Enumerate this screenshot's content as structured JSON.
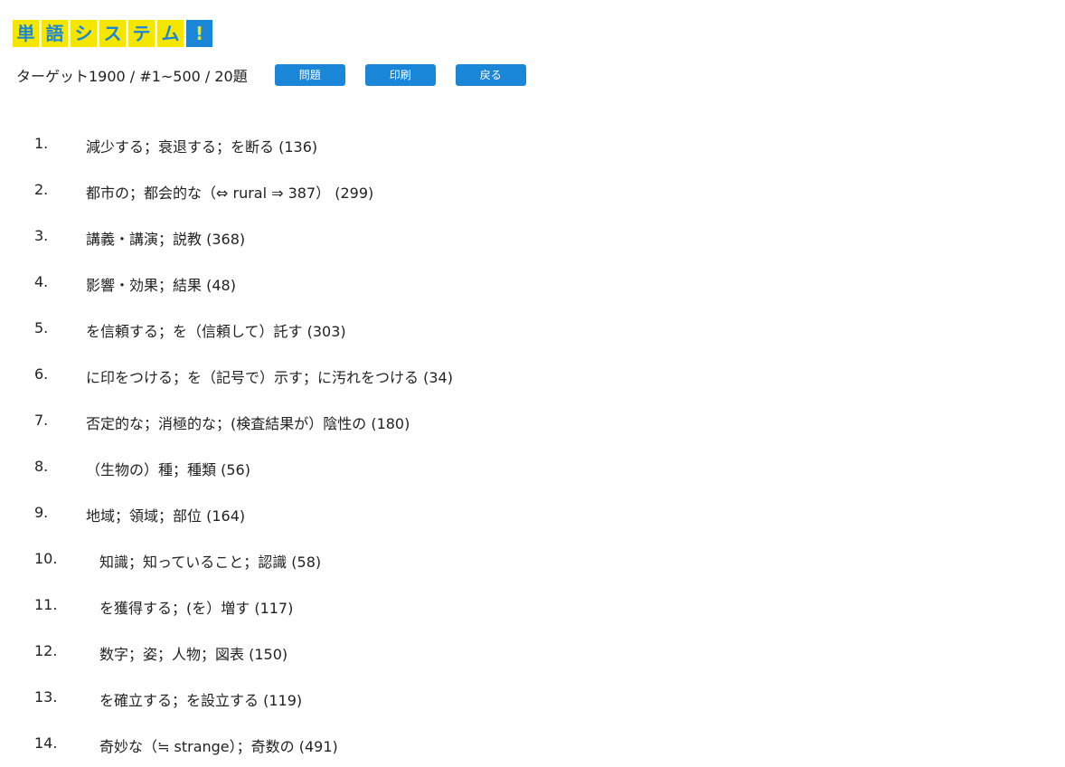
{
  "logo": {
    "chars": [
      "単",
      "語",
      "シ",
      "ス",
      "テ",
      "ム",
      "!"
    ],
    "colors": {
      "tile_bg": "#f5e600",
      "tile_fg": "#1a86d8"
    }
  },
  "header": {
    "title": "ターゲット1900 / #1~500 / 20題",
    "buttons": {
      "question": "問題",
      "print": "印刷",
      "back": "戻る"
    },
    "accent": "#1a86d8"
  },
  "items": [
    {
      "num": "1.",
      "text": "減少する；衰退する；を断る (136)"
    },
    {
      "num": "2.",
      "text": "都市の；都会的な（⇔ rural ⇒ 387） (299)"
    },
    {
      "num": "3.",
      "text": "講義・講演；説教 (368)"
    },
    {
      "num": "4.",
      "text": "影響・効果；結果 (48)"
    },
    {
      "num": "5.",
      "text": "を信頼する；を（信頼して）託す (303)"
    },
    {
      "num": "6.",
      "text": "に印をつける；を（記号で）示す；に汚れをつける (34)"
    },
    {
      "num": "7.",
      "text": "否定的な；消極的な；(検査結果が）陰性の (180)"
    },
    {
      "num": "8.",
      "text": "（生物の）種；種類 (56)"
    },
    {
      "num": "9.",
      "text": "地域；領域；部位 (164)"
    },
    {
      "num": "10.",
      "text": "知識；知っていること；認識 (58)"
    },
    {
      "num": "11.",
      "text": "を獲得する；(を）増す (117)"
    },
    {
      "num": "12.",
      "text": "数字；姿；人物；図表 (150)"
    },
    {
      "num": "13.",
      "text": "を確立する；を設立する (119)"
    },
    {
      "num": "14.",
      "text": "奇妙な（≒ strange）；奇数の (491)"
    }
  ]
}
